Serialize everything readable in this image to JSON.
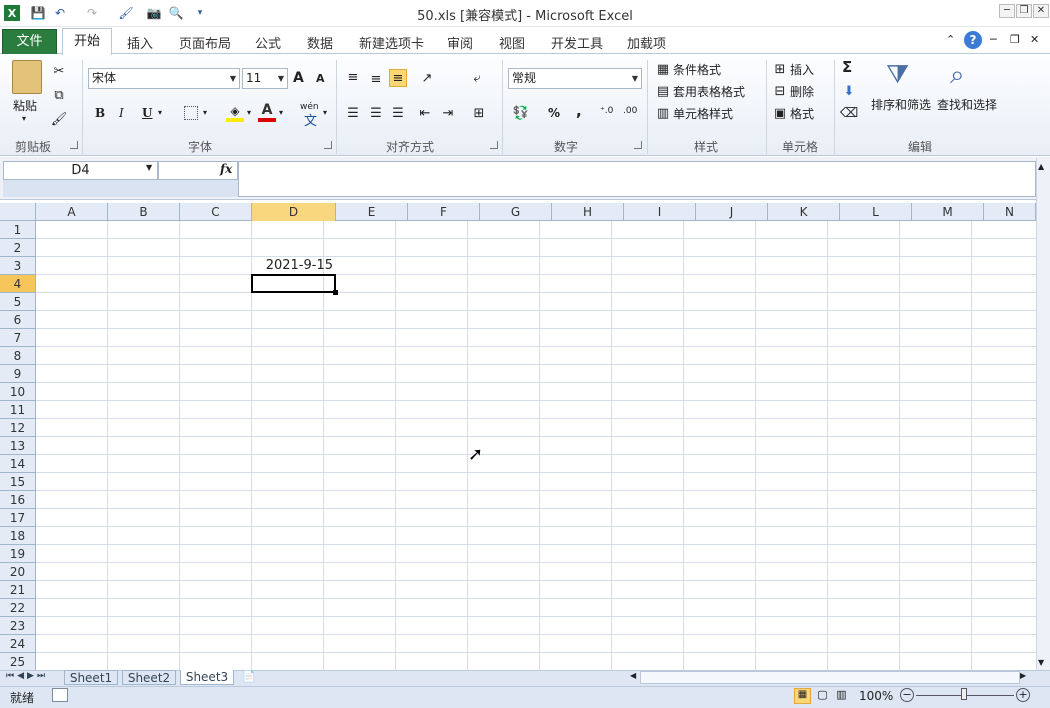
{
  "window": {
    "title": "50.xls  [兼容模式] - Microsoft Excel",
    "minimize": "─",
    "restore": "❐",
    "close": "✕"
  },
  "tabs": {
    "file": "文件",
    "home": "开始",
    "insert": "插入",
    "layout": "页面布局",
    "formulas": "公式",
    "data": "数据",
    "newtab": "新建选项卡",
    "review": "审阅",
    "view": "视图",
    "developer": "开发工具",
    "addins": "加载项"
  },
  "clipboard": {
    "paste": "粘贴",
    "label": "剪贴板"
  },
  "font": {
    "name": "宋体",
    "size": "11",
    "bold": "B",
    "italic": "I",
    "underline": "U",
    "label": "字体",
    "grow": "A",
    "shrink": "A",
    "wen": "wén"
  },
  "alignment": {
    "label": "对齐方式"
  },
  "number": {
    "format": "常规",
    "percent": "%",
    "comma": ",",
    "label": "数字"
  },
  "styles": {
    "conditional": "条件格式",
    "table": "套用表格格式",
    "cell": "单元格样式",
    "label": "样式"
  },
  "cells": {
    "insert": "插入",
    "delete": "删除",
    "format": "格式",
    "label": "单元格"
  },
  "editing": {
    "sum": "Σ",
    "sort": "排序和筛选",
    "find": "查找和选择",
    "label": "编辑"
  },
  "namebox": "D4",
  "fx": "fx",
  "columns": [
    "A",
    "B",
    "C",
    "D",
    "E",
    "F",
    "G",
    "H",
    "I",
    "J",
    "K",
    "L",
    "M",
    "N"
  ],
  "rows": [
    "1",
    "2",
    "3",
    "4",
    "5",
    "6",
    "7",
    "8",
    "9",
    "10",
    "11",
    "12",
    "13",
    "14",
    "15",
    "16",
    "17",
    "18",
    "19",
    "20",
    "21",
    "22",
    "23",
    "24",
    "25"
  ],
  "cell_D3": "2021-9-15",
  "sheets": [
    "Sheet1",
    "Sheet2",
    "Sheet3"
  ],
  "status": {
    "ready": "就绪",
    "zoom": "100%",
    "minus": "−",
    "plus": "+"
  },
  "colors": {
    "file_tab": "#2a7d3e",
    "selected_header": "#f9d77e",
    "selected_row_header": "#f6c65a"
  }
}
